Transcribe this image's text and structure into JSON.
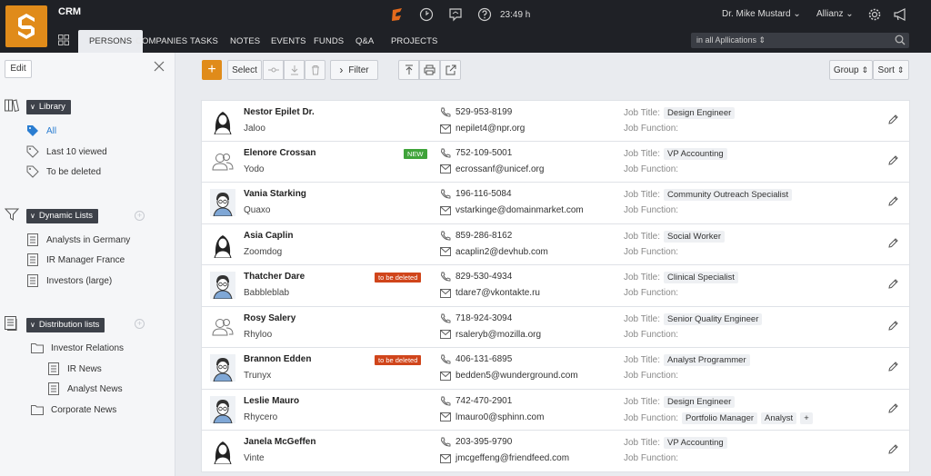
{
  "app": {
    "title": "CRM",
    "time": "23:49 h",
    "user": "Dr. Mike Mustard",
    "company": "Allianz"
  },
  "nav": {
    "tabs": [
      {
        "label": "PERSONS",
        "active": true
      },
      {
        "label": "COMPANIES"
      },
      {
        "label": "TASKS"
      },
      {
        "label": "NOTES"
      },
      {
        "label": "EVENTS"
      },
      {
        "label": "FUNDS"
      },
      {
        "label": "Q&A"
      },
      {
        "label": "PROJECTS"
      }
    ]
  },
  "search": {
    "placeholder": "in all Apllications ⇕"
  },
  "sidebar": {
    "edit_label": "Edit",
    "library": {
      "title": "Library",
      "items": [
        "All",
        "Last 10 viewed",
        "To be deleted"
      ]
    },
    "dynamic_lists": {
      "title": "Dynamic Lists",
      "items": [
        "Analysts in Germany",
        "IR Manager France",
        "Investors (large)"
      ]
    },
    "distribution_lists": {
      "title": "Distribution lists",
      "items": [
        "Investor Relations",
        "IR News",
        "Analyst News",
        "Corporate News"
      ]
    }
  },
  "toolbar": {
    "select_label": "Select",
    "filter_label": "Filter",
    "group_label": "Group",
    "sort_label": "Sort"
  },
  "labels": {
    "job_title": "Job Title:",
    "job_function": "Job Function:"
  },
  "persons": [
    {
      "name": "Nestor Epilet  Dr.",
      "company": "Jaloo",
      "phone": "529-953-8199",
      "email": "nepilet4@npr.org",
      "job_title": "Design Engineer",
      "job_functions": [],
      "avatar": "female",
      "badge": ""
    },
    {
      "name": "Elenore Crossan",
      "company": "Yodo",
      "phone": "752-109-5001",
      "email": "ecrossanf@unicef.org",
      "job_title": "VP Accounting",
      "job_functions": [],
      "avatar": "generic",
      "badge": "NEW"
    },
    {
      "name": "Vania Starking",
      "company": "Quaxo",
      "phone": "196-116-5084",
      "email": "vstarkinge@domainmarket.com",
      "job_title": "Community Outreach Specialist",
      "job_functions": [],
      "avatar": "male",
      "badge": ""
    },
    {
      "name": "Asia Caplin",
      "company": "Zoomdog",
      "phone": "859-286-8162",
      "email": "acaplin2@devhub.com",
      "job_title": "Social Worker",
      "job_functions": [],
      "avatar": "female",
      "badge": ""
    },
    {
      "name": "Thatcher Dare",
      "company": "Babbleblab",
      "phone": "829-530-4934",
      "email": "tdare7@vkontakte.ru",
      "job_title": "Clinical Specialist",
      "job_functions": [],
      "avatar": "male",
      "badge": "to be deleted"
    },
    {
      "name": "Rosy Salery",
      "company": "Rhyloo",
      "phone": "718-924-3094",
      "email": "rsaleryb@mozilla.org",
      "job_title": "Senior Quality Engineer",
      "job_functions": [],
      "avatar": "generic",
      "badge": ""
    },
    {
      "name": "Brannon Edden",
      "company": "Trunyx",
      "phone": "406-131-6895",
      "email": "bedden5@wunderground.com",
      "job_title": "Analyst Programmer",
      "job_functions": [],
      "avatar": "male",
      "badge": "to be deleted"
    },
    {
      "name": "Leslie Mauro",
      "company": "Rhycero",
      "phone": "742-470-2901",
      "email": "lmauro0@sphinn.com",
      "job_title": "Design Engineer",
      "job_functions": [
        "Portfolio Manager",
        "Analyst",
        "+"
      ],
      "avatar": "male",
      "badge": ""
    },
    {
      "name": "Janela McGeffen",
      "company": "Vinte",
      "phone": "203-395-9790",
      "email": "jmcgeffeng@friendfeed.com",
      "job_title": "VP Accounting",
      "job_functions": [],
      "avatar": "female",
      "badge": ""
    }
  ],
  "colors": {
    "accent": "#e08b1a",
    "topbar": "#1f2126",
    "link": "#2a7dd1",
    "new_badge": "#3fa33a",
    "delete_badge": "#d0451b"
  }
}
